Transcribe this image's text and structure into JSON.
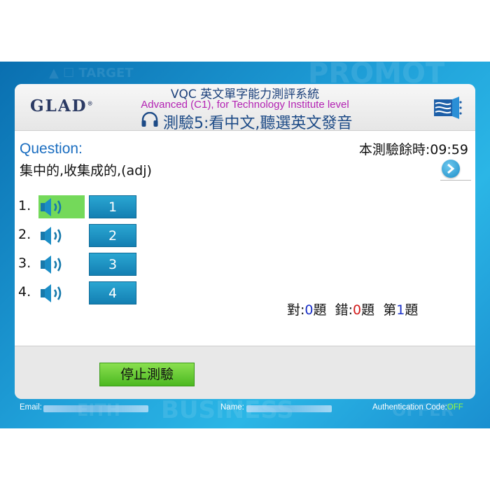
{
  "app": {
    "logo_text": "GLAD",
    "logo_mark": "®",
    "title_line1": "VQC 英文單字能力測評系統",
    "title_line2": "Advanced (C1), for Technology Institute level",
    "title_line3": "測驗5:看中文,聽選英文發音"
  },
  "question": {
    "label": "Question:",
    "text": "集中的,收集成的,(adj)",
    "timer_text": "本測驗餘時:09:59"
  },
  "options": [
    {
      "num": "1.",
      "label": "1",
      "selected": true
    },
    {
      "num": "2.",
      "label": "2",
      "selected": false
    },
    {
      "num": "3.",
      "label": "3",
      "selected": false
    },
    {
      "num": "4.",
      "label": "4",
      "selected": false
    }
  ],
  "score": {
    "correct_label": "對:",
    "correct_value": "0",
    "correct_unit": "題",
    "wrong_label": "錯:",
    "wrong_value": "0",
    "wrong_unit": "題",
    "current_prefix": "第",
    "current_value": "1",
    "current_unit": "題"
  },
  "footer": {
    "stop_label": "停止測驗"
  },
  "bottom_bar": {
    "email_label": "Email:",
    "name_label": "Name:",
    "auth_label": "Authentication Code:",
    "auth_value": "OFF"
  },
  "colors": {
    "accent_blue": "#1a6dc0",
    "selected_green": "#74d95a",
    "answer_button": "#1b92c4",
    "stop_button": "#6ccc38",
    "auth_off": "#9cff3a"
  },
  "icons": [
    "headphones-icon",
    "speaker-icon",
    "next-arrow-icon",
    "brand-book-icon"
  ]
}
